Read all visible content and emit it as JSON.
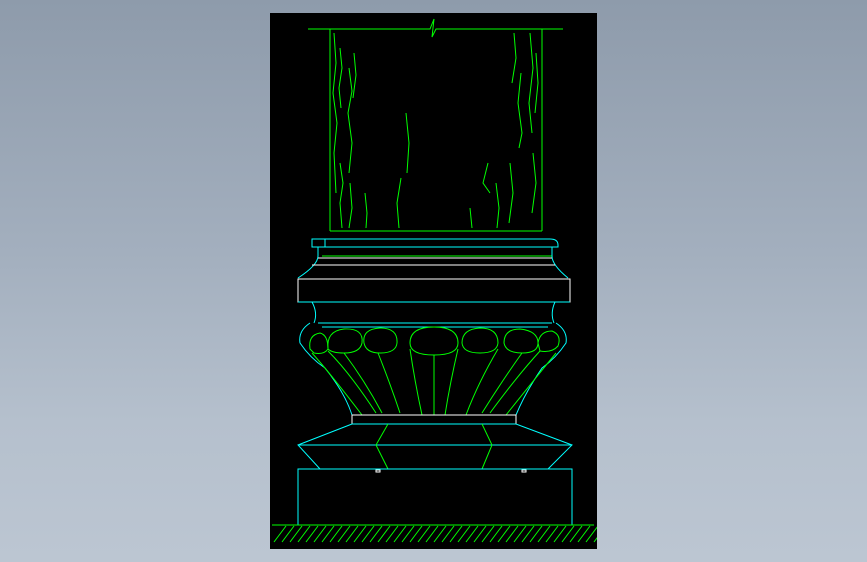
{
  "drawing": {
    "subject": "column-base-elevation",
    "colors": {
      "background_gradient_top": "#8e9bab",
      "background_gradient_bottom": "#bcc6d2",
      "viewport_background": "#000000",
      "outline": "#00ffff",
      "detail": "#00ff00",
      "edge": "#ffffff"
    }
  }
}
